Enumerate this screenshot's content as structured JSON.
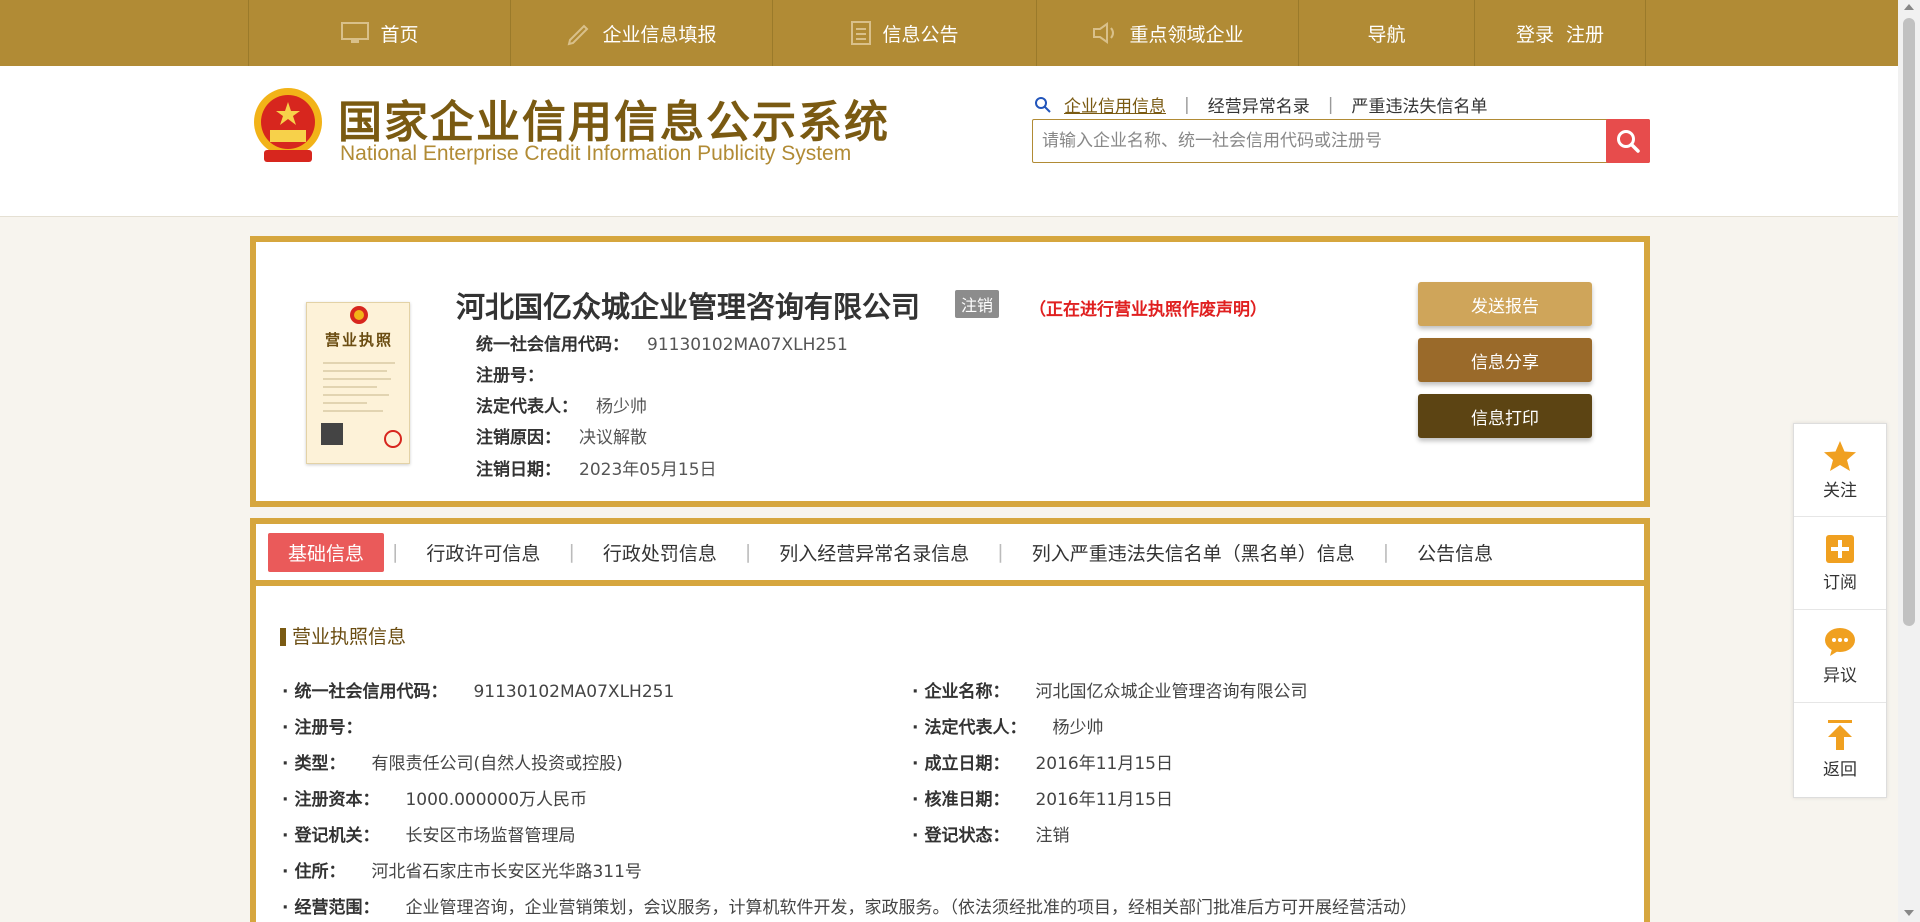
{
  "nav": {
    "items": [
      {
        "label": "首页",
        "icon": "monitor-icon"
      },
      {
        "label": "企业信息填报",
        "icon": "pen-icon"
      },
      {
        "label": "信息公告",
        "icon": "document-icon"
      },
      {
        "label": "重点领域企业",
        "icon": "speaker-icon"
      },
      {
        "label": "导航",
        "icon": ""
      }
    ],
    "login": "登录",
    "register": "注册"
  },
  "header": {
    "title_cn": "国家企业信用信息公示系统",
    "title_en": "National Enterprise Credit Information Publicity System",
    "search_tabs": [
      "企业信用信息",
      "经营异常名录",
      "严重违法失信名单"
    ],
    "search_placeholder": "请输入企业名称、统一社会信用代码或注册号"
  },
  "company": {
    "name": "河北国亿众城企业管理咨询有限公司",
    "status_tag": "注销",
    "notice": "（正在进行营业执照作废声明）",
    "license_label": "营业执照",
    "fields": [
      {
        "label": "统一社会信用代码：",
        "value": "91130102MA07XLH251"
      },
      {
        "label": "注册号：",
        "value": ""
      },
      {
        "label": "法定代表人：",
        "value": "杨少帅"
      },
      {
        "label": "注销原因：",
        "value": "决议解散"
      },
      {
        "label": "注销日期：",
        "value": "2023年05月15日"
      }
    ],
    "buttons": {
      "send_report": "发送报告",
      "share": "信息分享",
      "print": "信息打印"
    }
  },
  "tabs": [
    "基础信息",
    "行政许可信息",
    "行政处罚信息",
    "列入经营异常名录信息",
    "列入严重违法失信名单（黑名单）信息",
    "公告信息"
  ],
  "section": {
    "title": "营业执照信息",
    "left": [
      {
        "label": "统一社会信用代码：",
        "value": "91130102MA07XLH251"
      },
      {
        "label": "注册号：",
        "value": ""
      },
      {
        "label": "类型：",
        "value": "有限责任公司(自然人投资或控股)"
      },
      {
        "label": "注册资本：",
        "value": "1000.000000万人民币"
      },
      {
        "label": "登记机关：",
        "value": "长安区市场监督管理局"
      },
      {
        "label": "住所：",
        "value": "河北省石家庄市长安区光华路311号"
      },
      {
        "label": "经营范围：",
        "value": "企业管理咨询，企业营销策划，会议服务，计算机软件开发，家政服务。（依法须经批准的项目，经相关部门批准后方可开展经营活动）"
      }
    ],
    "right": [
      {
        "label": "企业名称：",
        "value": "河北国亿众城企业管理咨询有限公司"
      },
      {
        "label": "法定代表人：",
        "value": "杨少帅"
      },
      {
        "label": "成立日期：",
        "value": "2016年11月15日"
      },
      {
        "label": "核准日期：",
        "value": "2016年11月15日"
      },
      {
        "label": "登记状态：",
        "value": "注销"
      }
    ]
  },
  "float": [
    {
      "label": "关注",
      "icon": "star-icon"
    },
    {
      "label": "订阅",
      "icon": "plus-icon"
    },
    {
      "label": "异议",
      "icon": "chat-icon"
    },
    {
      "label": "返回",
      "icon": "arrow-up-icon"
    }
  ],
  "colors": {
    "gold": "#b18b35",
    "border_gold": "#d6a63e",
    "red": "#e74c4c"
  }
}
